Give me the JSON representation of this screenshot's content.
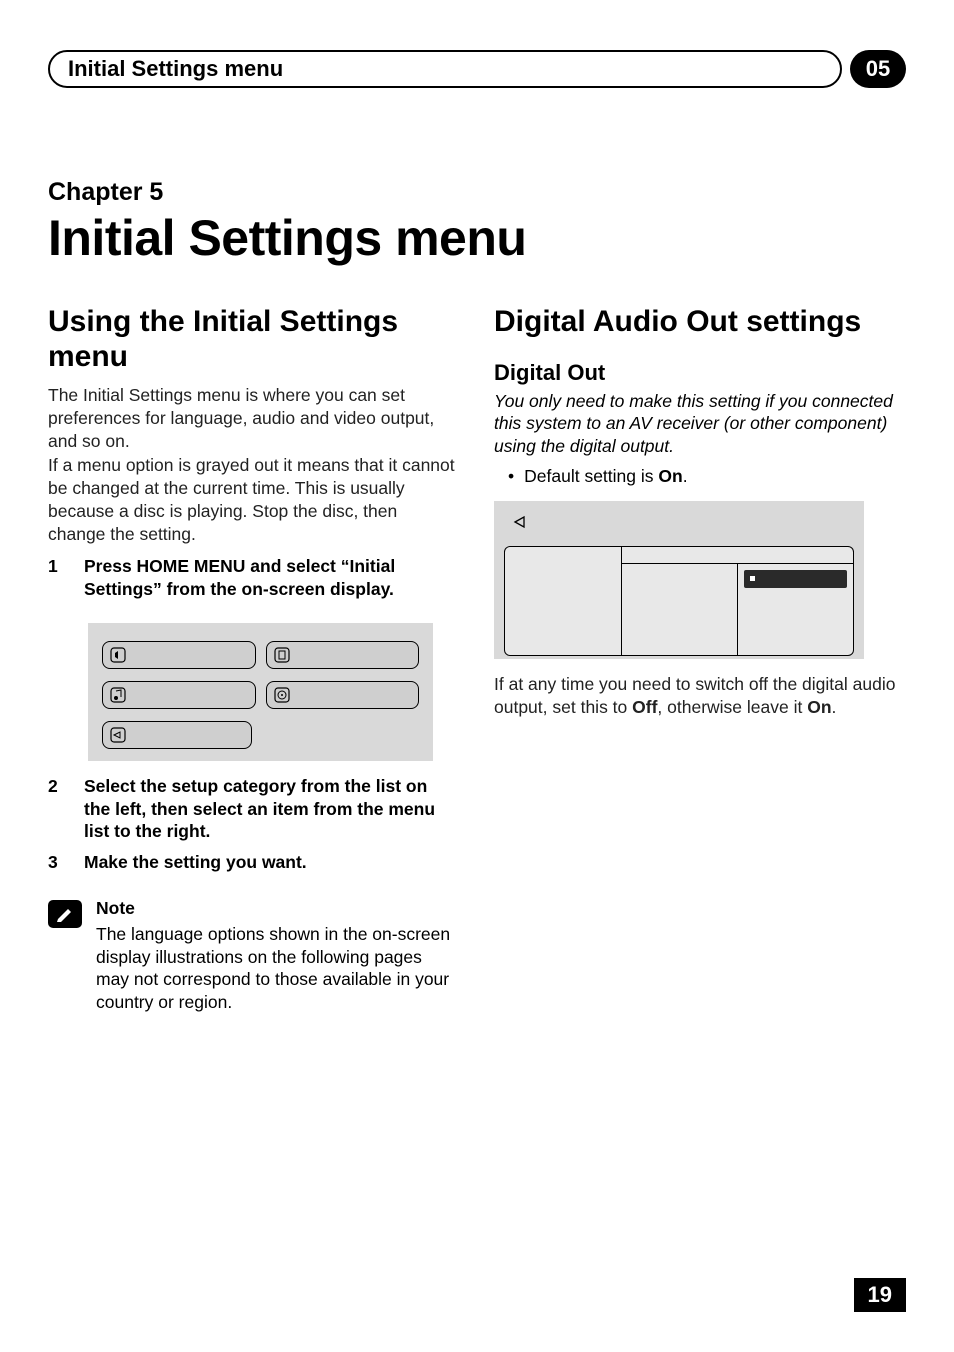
{
  "header": {
    "title": "Initial Settings menu",
    "badge": "05"
  },
  "chapter": {
    "label": "Chapter 5",
    "title": "Initial Settings menu"
  },
  "left": {
    "heading": "Using the Initial Set­tings menu",
    "para1": "The Initial Settings menu is where you can set preferences for language, audio and video output, and so on.",
    "para2": "If a menu option is grayed out it means that it cannot be changed at the current time. This is usually because a disc is playing. Stop the disc, then change the setting.",
    "steps": [
      {
        "num": "1",
        "text": "Press HOME MENU and select “Initial Settings” from the on-screen display."
      },
      {
        "num": "2",
        "text": "Select the setup category from the list on the left, then select an item from the menu list to the right."
      },
      {
        "num": "3",
        "text": "Make the setting you want."
      }
    ],
    "note": {
      "label": "Note",
      "text": "The language options shown in the on-screen display illustrations on the following pages may not correspond to those available in your country or region."
    }
  },
  "right": {
    "heading": "Digital Audio Out set­tings",
    "sub": "Digital Out",
    "italic_text": "You only need to make this setting if you connected this system to an AV receiver (or other component) using the digital output.",
    "bullet_prefix": "Default setting is ",
    "bullet_bold": "On",
    "bullet_suffix": ".",
    "after_prefix": "If at any time you need to switch off the digital audio output, set this to ",
    "after_b1": "Off",
    "after_mid": ", otherwise leave it ",
    "after_b2": "On",
    "after_suffix": "."
  },
  "page_number": "19"
}
